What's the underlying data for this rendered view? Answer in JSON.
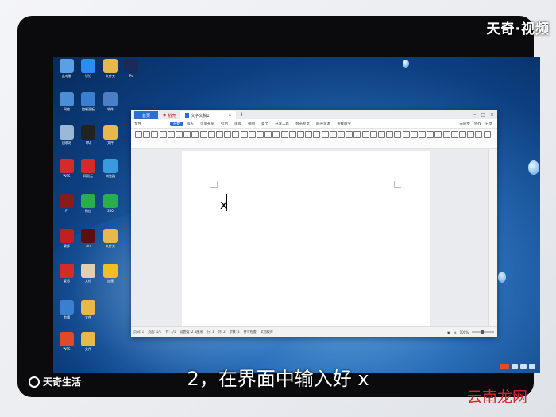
{
  "brand": {
    "top": "天奇·视频",
    "bottom": "天奇生活",
    "watermark": "云南龙网"
  },
  "caption": "2，在界面中输入好 x",
  "window": {
    "tabs": [
      {
        "name": "home",
        "label": "首页"
      },
      {
        "name": "wps",
        "label": "稻壳"
      },
      {
        "name": "doc",
        "label": "文字文稿1"
      }
    ],
    "menu": [
      "文件",
      "",
      "",
      "",
      "",
      "开始",
      "插入",
      "页面布局",
      "引用",
      "审阅",
      "视图",
      "章节",
      "开发工具",
      "会员专享",
      "稻壳资源",
      "查找命令"
    ],
    "menu_right": [
      "未同步",
      "协作",
      "分享"
    ],
    "typed_text": "x",
    "status": [
      "页码: 1",
      "页面: 1/1",
      "节: 1/1",
      "设置值: 2.5厘米",
      "行: 1",
      "列: 2",
      "字数: 1",
      "拼写检查",
      "文档校对"
    ],
    "zoom": "100%"
  },
  "desktop_icons": [
    {
      "label": "此电脑",
      "color": "#5aa0e6"
    },
    {
      "label": "钉钉",
      "color": "#2c8cf4"
    },
    {
      "label": "文件夹",
      "color": "#e8b84a"
    },
    {
      "label": "Ps",
      "color": "#1a2a5a"
    },
    {
      "label": "网络",
      "color": "#4a8fd6"
    },
    {
      "label": "控制面板",
      "color": "#3a7fd0"
    },
    {
      "label": "软件",
      "color": "#4a7fc6"
    },
    {
      "label": "回收站",
      "color": "#9ab8d8"
    },
    {
      "label": "QQ",
      "color": "#222"
    },
    {
      "label": "文件",
      "color": "#e8b84a"
    },
    {
      "label": "WPS",
      "color": "#d62a2a"
    },
    {
      "label": "网易云",
      "color": "#d62a2a"
    },
    {
      "label": "浏览器",
      "color": "#3a9ae0"
    },
    {
      "label": "Fl",
      "color": "#8b1a1a"
    },
    {
      "label": "微信",
      "color": "#2aae4a"
    },
    {
      "label": "360",
      "color": "#2aae4a"
    },
    {
      "label": "录屏",
      "color": "#c22020"
    },
    {
      "label": "An",
      "color": "#5a1010"
    },
    {
      "label": "文件夹",
      "color": "#e8b84a"
    },
    {
      "label": "爱思",
      "color": "#d62a2a"
    },
    {
      "label": "文档",
      "color": "#e0d0b0"
    },
    {
      "label": "加速",
      "color": "#f0c020"
    },
    {
      "label": "剪辑",
      "color": "#3a7fd0"
    },
    {
      "label": "文件",
      "color": "#e8b84a"
    },
    {
      "label": "WPS",
      "color": "#e04a2a"
    },
    {
      "label": "文件",
      "color": "#e8b84a"
    }
  ]
}
